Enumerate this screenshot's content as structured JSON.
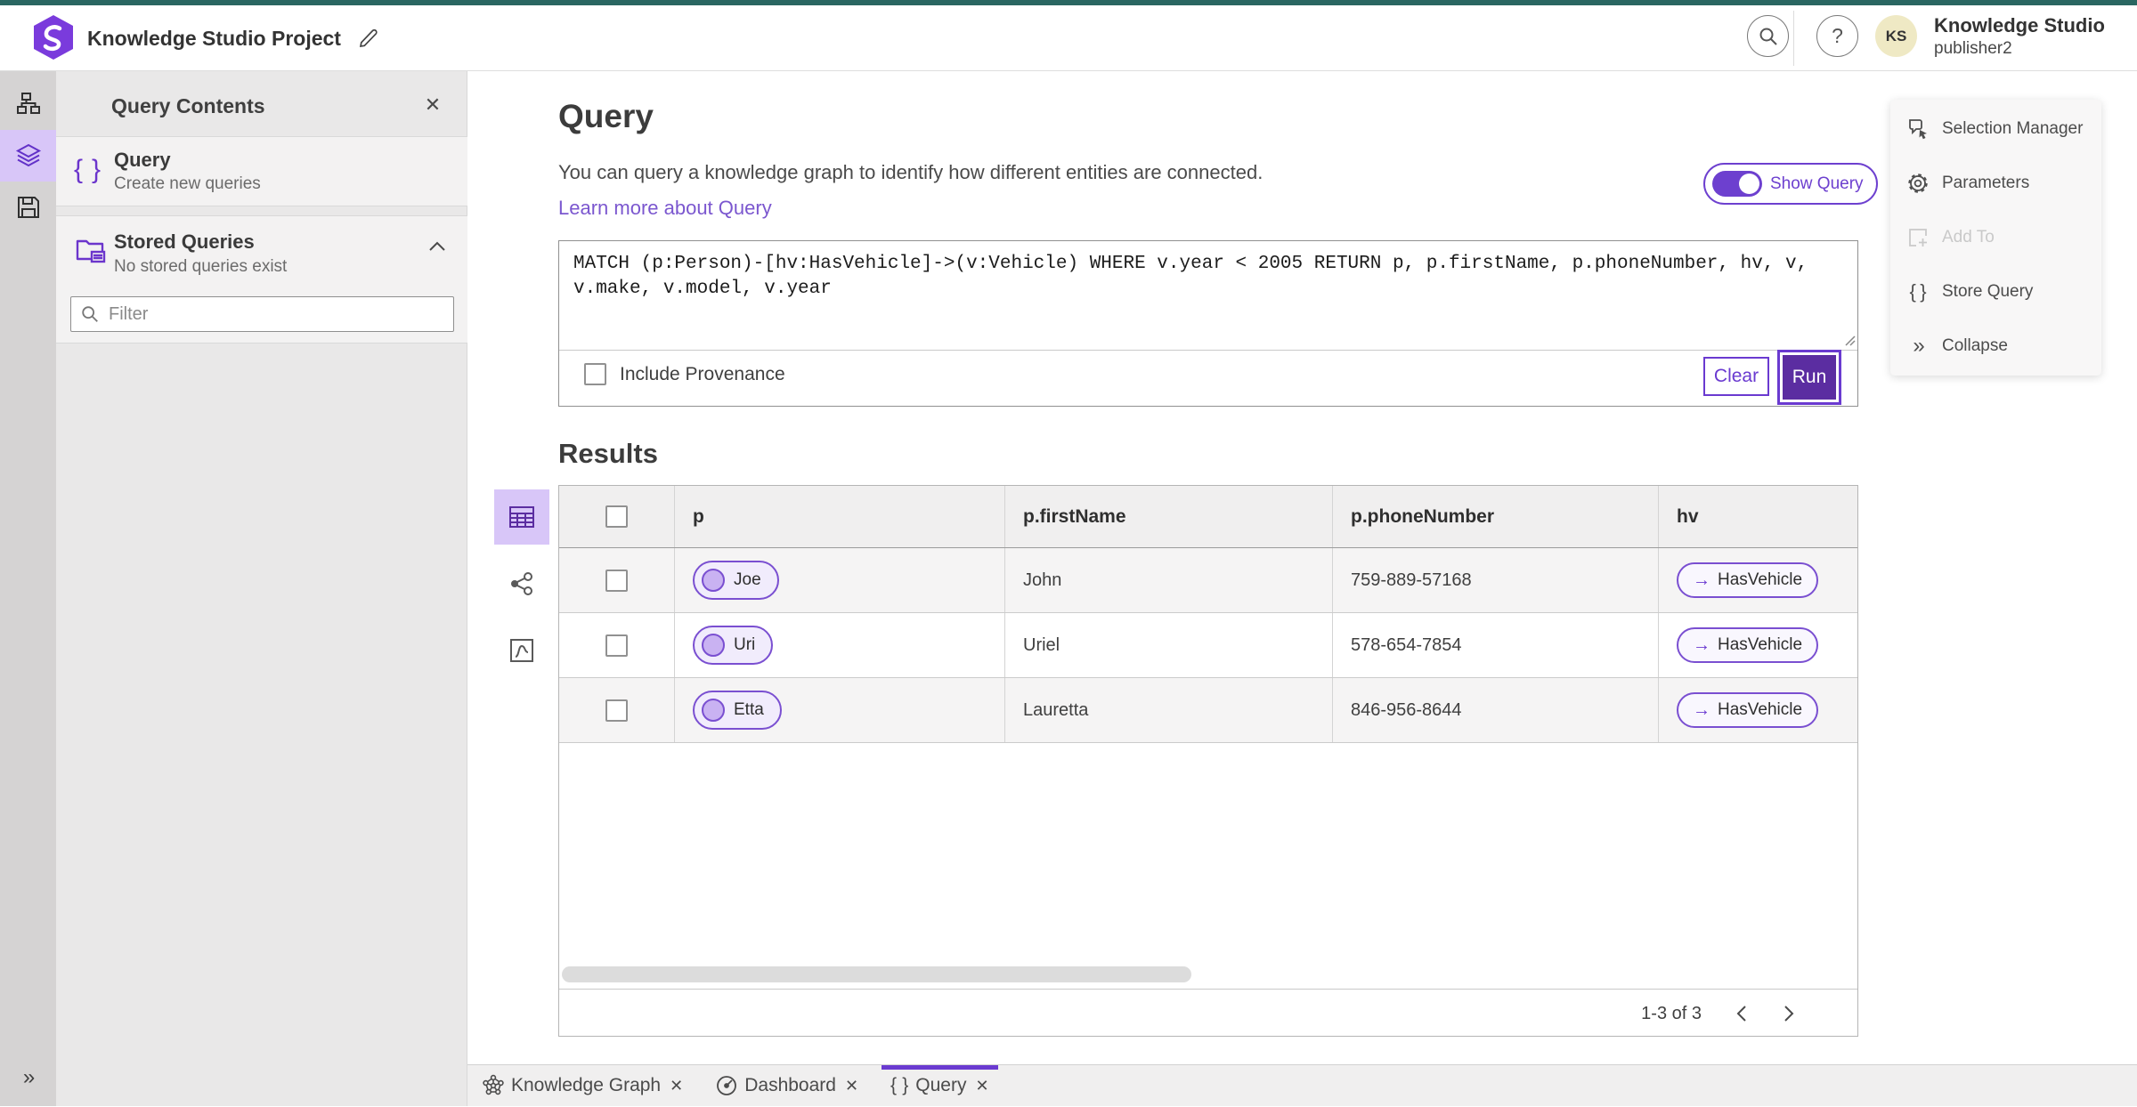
{
  "header": {
    "project_title": "Knowledge Studio Project",
    "app_name": "Knowledge Studio",
    "username": "publisher2",
    "avatar_initials": "KS"
  },
  "panel": {
    "title": "Query Contents",
    "query_item": {
      "title": "Query",
      "subtitle": "Create new queries"
    },
    "stored_queries": {
      "title": "Stored Queries",
      "subtitle": "No stored queries exist"
    },
    "filter_placeholder": "Filter"
  },
  "query_section": {
    "title": "Query",
    "description": "You can query a knowledge graph to identify how different entities are connected.",
    "learn_more": "Learn more about Query",
    "show_query_label": "Show Query",
    "query_text": "MATCH (p:Person)-[hv:HasVehicle]->(v:Vehicle) WHERE v.year < 2005 RETURN p, p.firstName, p.phoneNumber, hv, v, v.make, v.model, v.year",
    "include_provenance": "Include Provenance",
    "clear": "Clear",
    "run": "Run"
  },
  "results": {
    "title": "Results",
    "columns": [
      "p",
      "p.firstName",
      "p.phoneNumber",
      "hv"
    ],
    "rows": [
      {
        "p": "Joe",
        "firstName": "John",
        "phoneNumber": "759-889-57168",
        "hv": "HasVehicle"
      },
      {
        "p": "Uri",
        "firstName": "Uriel",
        "phoneNumber": "578-654-7854",
        "hv": "HasVehicle"
      },
      {
        "p": "Etta",
        "firstName": "Lauretta",
        "phoneNumber": "846-956-8644",
        "hv": "HasVehicle"
      }
    ],
    "pagination": "1-3 of 3"
  },
  "right_menu": {
    "items": [
      {
        "label": "Selection Manager"
      },
      {
        "label": "Parameters"
      },
      {
        "label": "Add To",
        "disabled": true
      },
      {
        "label": "Store Query"
      },
      {
        "label": "Collapse"
      }
    ]
  },
  "tabs": [
    {
      "label": "Knowledge Graph"
    },
    {
      "label": "Dashboard"
    },
    {
      "label": "Query",
      "active": true
    }
  ],
  "colors": {
    "accent": "#6a3ad0",
    "run_button": "#5b2da1",
    "link": "#7b57cf",
    "selected_bg": "#d8c6f8",
    "top_strip": "#2a6661"
  }
}
